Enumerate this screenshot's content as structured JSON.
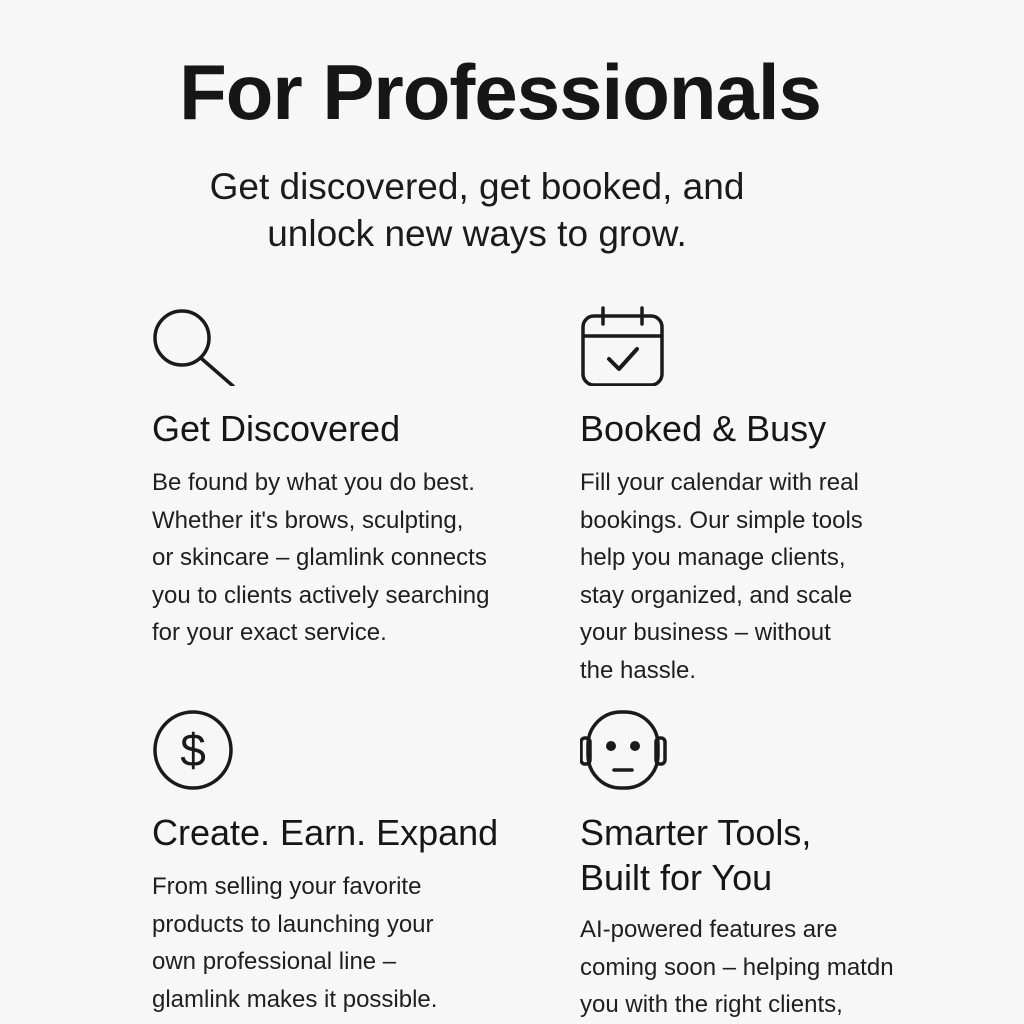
{
  "page": {
    "title": "For Professionals",
    "subtitle_lines": [
      "Get discovered, get booked, and",
      "unlock new ways to grow."
    ]
  },
  "features": [
    {
      "icon": "search-icon",
      "heading_lines": [
        "Get Discovered"
      ],
      "body_lines": [
        "Be found by what you do best.",
        "Whether it's brows, sculpting,",
        "or skincare – glamlink connects",
        "you to clients actively searching",
        "for your exact service."
      ]
    },
    {
      "icon": "calendar-check-icon",
      "heading_lines": [
        "Booked & Busy"
      ],
      "body_lines": [
        "Fill your calendar with real",
        "bookings. Our simple tools",
        "help you manage clients,",
        "stay organized, and scale",
        "your business – without",
        "the hassle."
      ]
    },
    {
      "icon": "dollar-circle-icon",
      "heading_lines": [
        "Create. Earn. Expand"
      ],
      "body_lines": [
        "From selling your favorite",
        "products to launching your",
        "own professional line –",
        "glamlink makes it possible."
      ]
    },
    {
      "icon": "robot-icon",
      "heading_lines": [
        "Smarter Tools,",
        "Built for You"
      ],
      "body_lines": [
        "AI-powered features are",
        "coming soon – helping matdn",
        "you with the right clients,"
      ]
    }
  ]
}
